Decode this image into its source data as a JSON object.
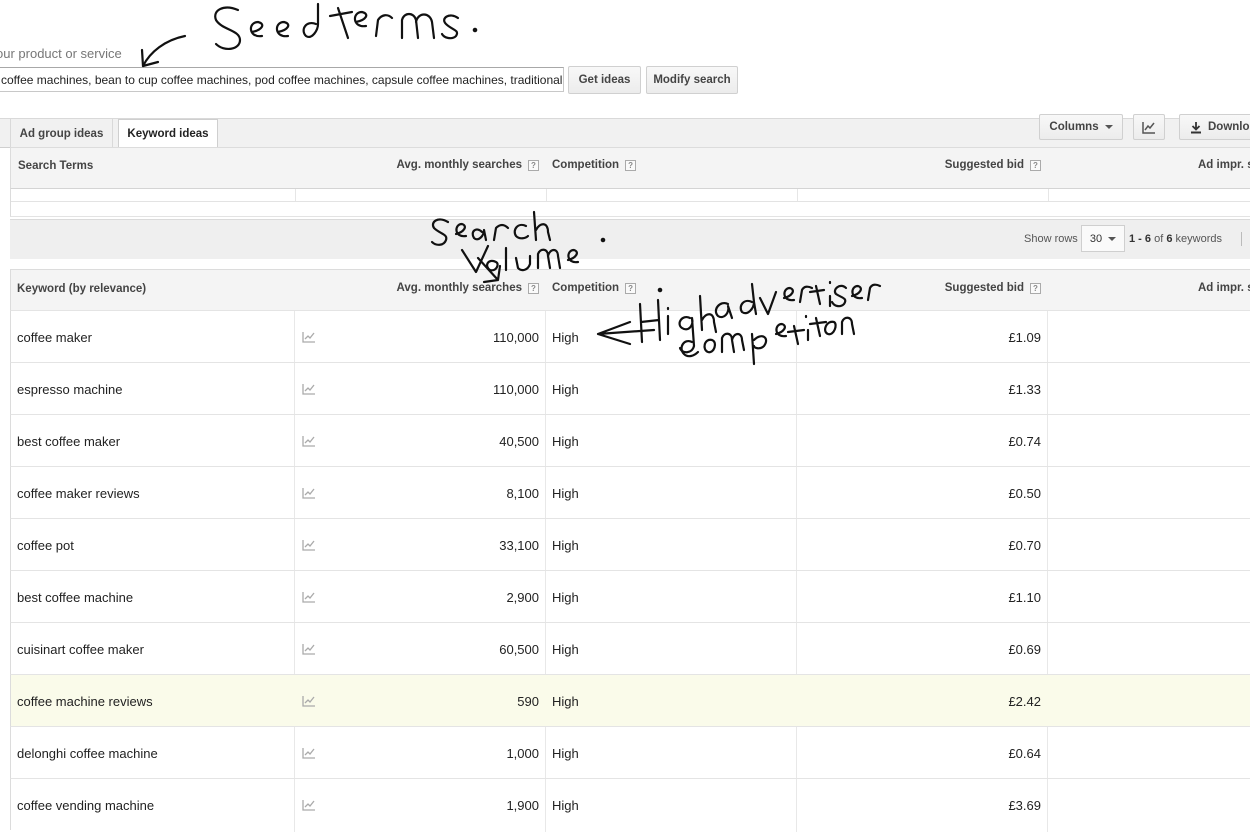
{
  "search_form": {
    "product_label": "our product or service",
    "seed_value": "coffee machines, bean to cup coffee machines, pod coffee machines, capsule coffee machines, traditional",
    "get_ideas": "Get ideas",
    "modify_search": "Modify search"
  },
  "tabs": [
    {
      "label": "Ad group ideas",
      "active": false
    },
    {
      "label": "Keyword ideas",
      "active": true
    }
  ],
  "toolbar": {
    "columns": "Columns",
    "download": "Downlo"
  },
  "search_terms_table": {
    "headers": {
      "term": "Search Terms",
      "avg": "Avg. monthly searches",
      "competition": "Competition",
      "bid": "Suggested bid",
      "impr": "Ad impr. s"
    },
    "help_glyph": "?"
  },
  "pager": {
    "show_rows": "Show rows",
    "rows_value": "30",
    "range": "1 - 6",
    "of": "of",
    "total": "6",
    "unit": "keywords"
  },
  "keyword_table": {
    "headers": {
      "keyword": "Keyword (by relevance)",
      "avg": "Avg. monthly searches",
      "competition": "Competition",
      "bid": "Suggested bid",
      "impr": "Ad impr. s"
    },
    "rows": [
      {
        "keyword": "coffee maker",
        "avg": "110,000",
        "competition": "High",
        "bid": "£1.09"
      },
      {
        "keyword": "espresso machine",
        "avg": "110,000",
        "competition": "High",
        "bid": "£1.33"
      },
      {
        "keyword": "best coffee maker",
        "avg": "40,500",
        "competition": "High",
        "bid": "£0.74"
      },
      {
        "keyword": "coffee maker reviews",
        "avg": "8,100",
        "competition": "High",
        "bid": "£0.50"
      },
      {
        "keyword": "coffee pot",
        "avg": "33,100",
        "competition": "High",
        "bid": "£0.70"
      },
      {
        "keyword": "best coffee machine",
        "avg": "2,900",
        "competition": "High",
        "bid": "£1.10"
      },
      {
        "keyword": "cuisinart coffee maker",
        "avg": "60,500",
        "competition": "High",
        "bid": "£0.69"
      },
      {
        "keyword": "coffee machine reviews",
        "avg": "590",
        "competition": "High",
        "bid": "£2.42",
        "highlighted": true
      },
      {
        "keyword": "delonghi coffee machine",
        "avg": "1,000",
        "competition": "High",
        "bid": "£0.64"
      },
      {
        "keyword": "coffee vending machine",
        "avg": "1,900",
        "competition": "High",
        "bid": "£3.69"
      }
    ]
  },
  "annotations": {
    "seed_terms": "Seed terms.",
    "search_volume": "Search Volume.",
    "high_competition": "High advertiser competition"
  },
  "colors": {
    "highlight_row": "#fafbea",
    "header_bg": "#f4f4f4",
    "ink": "#111111"
  }
}
